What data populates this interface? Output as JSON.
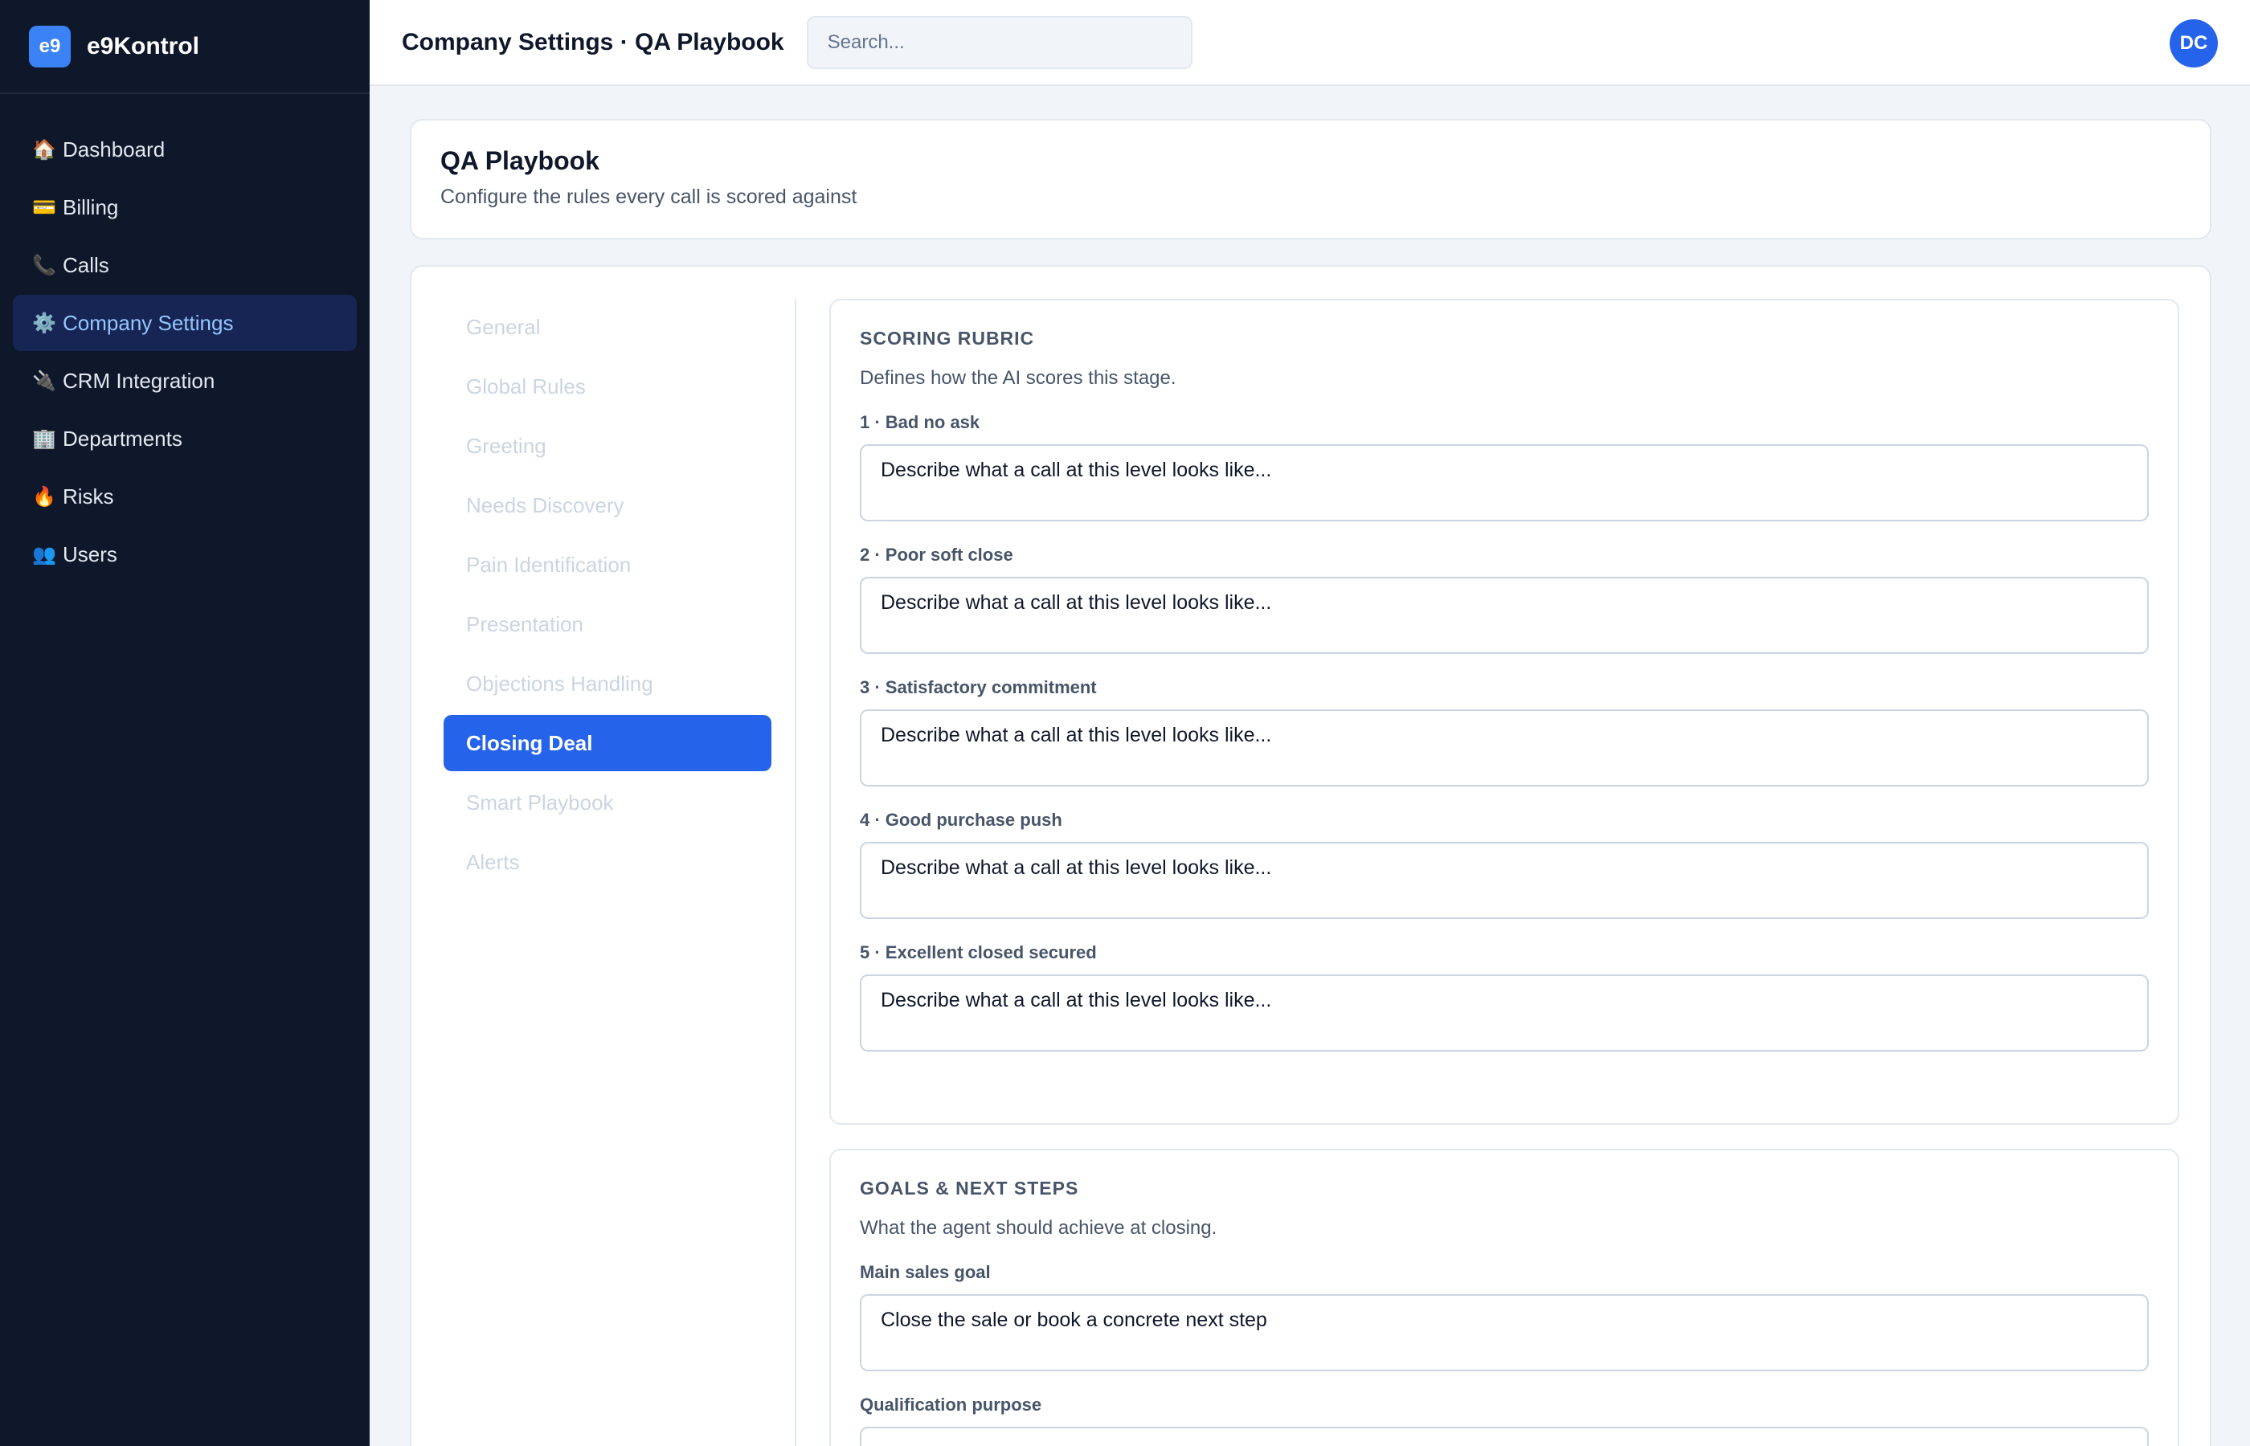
{
  "brand": {
    "logo": "e9",
    "name": "e9Kontrol"
  },
  "sidebar": {
    "items": [
      {
        "icon": "🏠",
        "icon_name": "house-icon",
        "label": "Dashboard",
        "active": false
      },
      {
        "icon": "💳",
        "icon_name": "credit-card-icon",
        "label": "Billing",
        "active": false
      },
      {
        "icon": "📞",
        "icon_name": "phone-icon",
        "label": "Calls",
        "active": false
      },
      {
        "icon": "⚙️",
        "icon_name": "gear-icon",
        "label": "Company Settings",
        "active": true
      },
      {
        "icon": "🔌",
        "icon_name": "plug-icon",
        "label": "CRM Integration",
        "active": false
      },
      {
        "icon": "🏢",
        "icon_name": "building-icon",
        "label": "Departments",
        "active": false
      },
      {
        "icon": "🔥",
        "icon_name": "fire-icon",
        "label": "Risks",
        "active": false
      },
      {
        "icon": "👥",
        "icon_name": "users-icon",
        "label": "Users",
        "active": false
      }
    ]
  },
  "topbar": {
    "title": "Company Settings · QA Playbook",
    "search_placeholder": "Search...",
    "avatar_initials": "DC"
  },
  "header": {
    "title": "QA Playbook",
    "subtitle": "Configure the rules every call is scored against"
  },
  "subnav": {
    "items": [
      "General",
      "Global Rules",
      "Greeting",
      "Needs Discovery",
      "Pain Identification",
      "Presentation",
      "Objections Handling",
      "Closing Deal",
      "Smart Playbook",
      "Alerts"
    ],
    "active": "Closing Deal"
  },
  "rubric": {
    "title": "SCORING RUBRIC",
    "description": "Defines how the AI scores this stage.",
    "levels": [
      {
        "label": "1 · Bad no ask",
        "placeholder": "Describe what a call at this level looks like..."
      },
      {
        "label": "2 · Poor soft close",
        "placeholder": "Describe what a call at this level looks like..."
      },
      {
        "label": "3 · Satisfactory commitment",
        "placeholder": "Describe what a call at this level looks like..."
      },
      {
        "label": "4 · Good purchase push",
        "placeholder": "Describe what a call at this level looks like..."
      },
      {
        "label": "5 · Excellent closed secured",
        "placeholder": "Describe what a call at this level looks like..."
      }
    ]
  },
  "goals": {
    "title": "GOALS & NEXT STEPS",
    "description": "What the agent should achieve at closing.",
    "main_goal_label": "Main sales goal",
    "main_goal_value": "Close the sale or book a concrete next step",
    "qualification_label": "Qualification purpose"
  },
  "colors": {
    "sidebar_bg": "#0f172a",
    "accent": "#2563eb",
    "active_nav_bg": "#172554",
    "active_nav_text": "#93c5fd"
  }
}
